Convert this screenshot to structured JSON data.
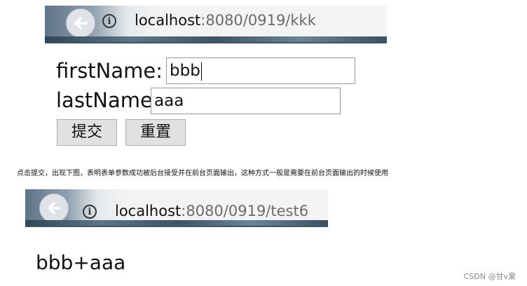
{
  "screenshot1": {
    "url_host": "localhost",
    "url_path": ":8080/0919/kkk",
    "first_name_label": "firstName:",
    "first_name_value": "bbb",
    "last_name_label": "lastName",
    "last_name_value": "aaa",
    "submit_label": "提交",
    "reset_label": "重置"
  },
  "caption": "点击提交，出现下图，表明表单参数成功被后台接受并在前台页面输出，这种方式一般是需要在前台页面输出的时候使用",
  "screenshot2": {
    "url_host": "localhost",
    "url_path": ":8080/0919/test6",
    "result_text": "bbb+aaa"
  },
  "watermark": "CSDN @甘v果",
  "icons": [
    "back-arrow-icon",
    "info-icon"
  ],
  "colors": {
    "toolbar_dark": "#3e5668",
    "button_bg": "#e1e1e1",
    "input_border": "#9a9a9a"
  }
}
